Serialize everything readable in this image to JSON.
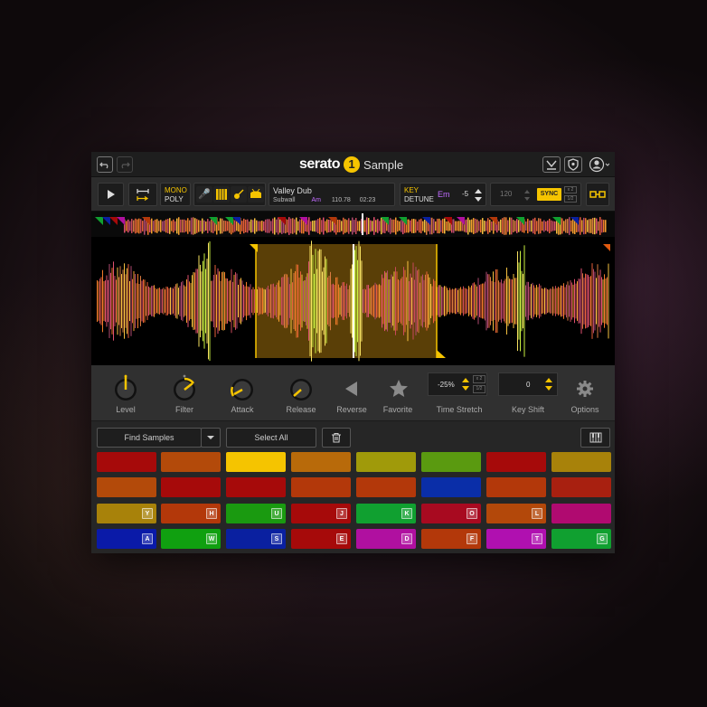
{
  "app": {
    "brand": "serato",
    "brand_mark": "1",
    "product": "Sample"
  },
  "toolbar": {
    "mono_label": "MONO",
    "poly_label": "POLY",
    "track_title": "Valley Dub",
    "track_artist": "Subwall",
    "track_key": "Am",
    "track_bpm": "110.78",
    "track_length": "02:23",
    "key_label": "KEY",
    "detune_label": "DETUNE",
    "key_value": "Em",
    "key_shift_value": "-5",
    "bpm_value": "120",
    "sync_label": "SYNC",
    "x2_label": "x 2",
    "half_label": "1/2"
  },
  "controls": {
    "level": "Level",
    "filter": "Filter",
    "attack": "Attack",
    "release": "Release",
    "reverse": "Reverse",
    "favorite": "Favorite",
    "time_stretch_label": "Time Stretch",
    "time_stretch_value": "-25%",
    "ts_x2": "x 2",
    "ts_half": "1/2",
    "key_shift_label": "Key Shift",
    "key_shift_value": "0",
    "options": "Options"
  },
  "pad_toolbar": {
    "find_samples": "Find Samples",
    "select_all": "Select All"
  },
  "colors": {
    "accent": "#f5c400",
    "key_purple": "#c06cff"
  },
  "pads": [
    {
      "color": "#a60a0a",
      "key": ""
    },
    {
      "color": "#b34a0a",
      "key": ""
    },
    {
      "color": "#f5c400",
      "key": ""
    },
    {
      "color": "#b86a0a",
      "key": ""
    },
    {
      "color": "#a09a0a",
      "key": ""
    },
    {
      "color": "#5a9a10",
      "key": ""
    },
    {
      "color": "#a60a0a",
      "key": ""
    },
    {
      "color": "#a8820a",
      "key": ""
    },
    {
      "color": "#b34a0a",
      "key": ""
    },
    {
      "color": "#a60a0a",
      "key": ""
    },
    {
      "color": "#a60a0a",
      "key": ""
    },
    {
      "color": "#b3380a",
      "key": ""
    },
    {
      "color": "#b3380a",
      "key": ""
    },
    {
      "color": "#0a2ea8",
      "key": ""
    },
    {
      "color": "#b3380a",
      "key": ""
    },
    {
      "color": "#a82010",
      "key": ""
    },
    {
      "color": "#a8820a",
      "key": "Y"
    },
    {
      "color": "#b3380a",
      "key": "H"
    },
    {
      "color": "#1a9a10",
      "key": "U"
    },
    {
      "color": "#a60a0a",
      "key": "J"
    },
    {
      "color": "#10a030",
      "key": "K"
    },
    {
      "color": "#a80a20",
      "key": "O"
    },
    {
      "color": "#b3480a",
      "key": "L"
    },
    {
      "color": "#b00a70",
      "key": ""
    },
    {
      "color": "#0a1aa8",
      "key": "A"
    },
    {
      "color": "#10a010",
      "key": "W"
    },
    {
      "color": "#0a20a0",
      "key": "S"
    },
    {
      "color": "#a60a0a",
      "key": "E"
    },
    {
      "color": "#b010a0",
      "key": "D"
    },
    {
      "color": "#b3380a",
      "key": "F"
    },
    {
      "color": "#b010b0",
      "key": "T"
    },
    {
      "color": "#10a030",
      "key": "G"
    }
  ]
}
